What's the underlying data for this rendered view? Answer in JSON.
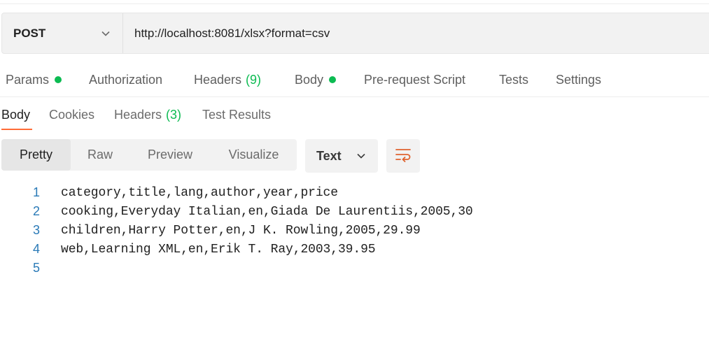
{
  "request": {
    "method": "POST",
    "url": "http://localhost:8081/xlsx?format=csv"
  },
  "request_tabs": [
    {
      "label": "Params",
      "dot": true
    },
    {
      "label": "Authorization"
    },
    {
      "label": "Headers",
      "count": "(9)"
    },
    {
      "label": "Body",
      "dot": true
    },
    {
      "label": "Pre-request Script"
    },
    {
      "label": "Tests"
    },
    {
      "label": "Settings"
    }
  ],
  "response_tabs": [
    {
      "label": "Body",
      "active": true
    },
    {
      "label": "Cookies"
    },
    {
      "label": "Headers",
      "count": "(3)"
    },
    {
      "label": "Test Results"
    }
  ],
  "view_modes": [
    {
      "label": "Pretty",
      "active": true
    },
    {
      "label": "Raw"
    },
    {
      "label": "Preview"
    },
    {
      "label": "Visualize"
    }
  ],
  "format_select": {
    "value": "Text",
    "icon": "chevron-down-icon"
  },
  "wrap_button": {
    "icon": "wrap-lines-icon"
  },
  "colors": {
    "accent": "#ff6c37",
    "status_green": "#0cbb52",
    "line_number": "#2a7ab7"
  },
  "code": {
    "lines": [
      {
        "num": "1",
        "text": "category,title,lang,author,year,price"
      },
      {
        "num": "2",
        "text": "cooking,Everyday Italian,en,Giada De Laurentiis,2005,30"
      },
      {
        "num": "3",
        "text": "children,Harry Potter,en,J K. Rowling,2005,29.99"
      },
      {
        "num": "4",
        "text": "web,Learning XML,en,Erik T. Ray,2003,39.95"
      },
      {
        "num": "5",
        "text": ""
      }
    ]
  }
}
